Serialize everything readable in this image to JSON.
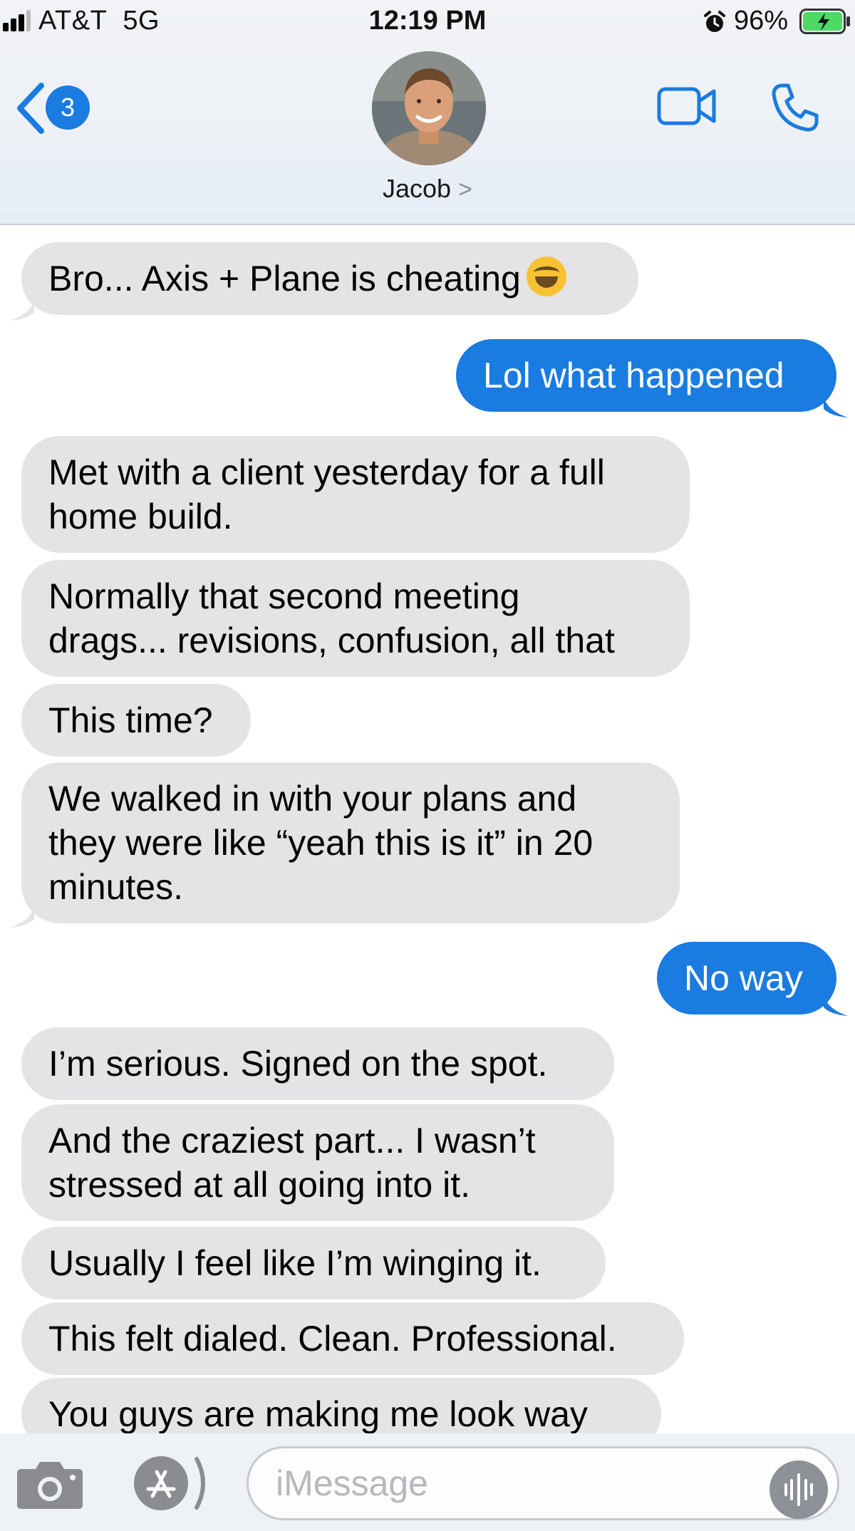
{
  "status_bar": {
    "carrier": "AT&T",
    "network": "5G",
    "time": "12:19 PM",
    "battery_percent": "96%",
    "battery_level": 0.96,
    "charging": true
  },
  "nav": {
    "unread_badge": "3",
    "contact_name": "Jacob",
    "contact_chevron": ">"
  },
  "messages": [
    {
      "from": "them",
      "text": "Bro... Axis + Plane is cheating",
      "emoji": "face-with-tears-of-joy"
    },
    {
      "from": "me",
      "text": "Lol what happened"
    },
    {
      "from": "them",
      "lines": [
        "Met with a client yesterday for a full",
        "home build."
      ]
    },
    {
      "from": "them",
      "lines": [
        "Normally that second meeting",
        "drags... revisions, confusion, all that"
      ]
    },
    {
      "from": "them",
      "text": "This time?"
    },
    {
      "from": "them",
      "lines": [
        "We walked in with your plans and",
        "they were like “yeah this is it” in 20",
        "minutes."
      ]
    },
    {
      "from": "me",
      "text": "No way"
    },
    {
      "from": "them",
      "text": "I’m serious. Signed on the spot."
    },
    {
      "from": "them",
      "lines": [
        "And the craziest part... I wasn’t",
        "stressed at all going into it."
      ]
    },
    {
      "from": "them",
      "text": "Usually I feel like I’m winging it."
    },
    {
      "from": "them",
      "text": "This felt dialed. Clean. Professional."
    },
    {
      "from": "them",
      "text": "You guys are making me look way"
    }
  ],
  "input": {
    "placeholder": "iMessage",
    "value": ""
  },
  "colors": {
    "sent_bubble": "#1a7be0",
    "received_bubble": "#e4e4e6",
    "accent": "#1a7be0"
  },
  "icons": [
    "signal-icon",
    "alarm-icon",
    "battery-icon",
    "back-chevron-icon",
    "video-call-icon",
    "phone-call-icon",
    "camera-icon",
    "app-store-icon",
    "audio-waveform-icon"
  ]
}
